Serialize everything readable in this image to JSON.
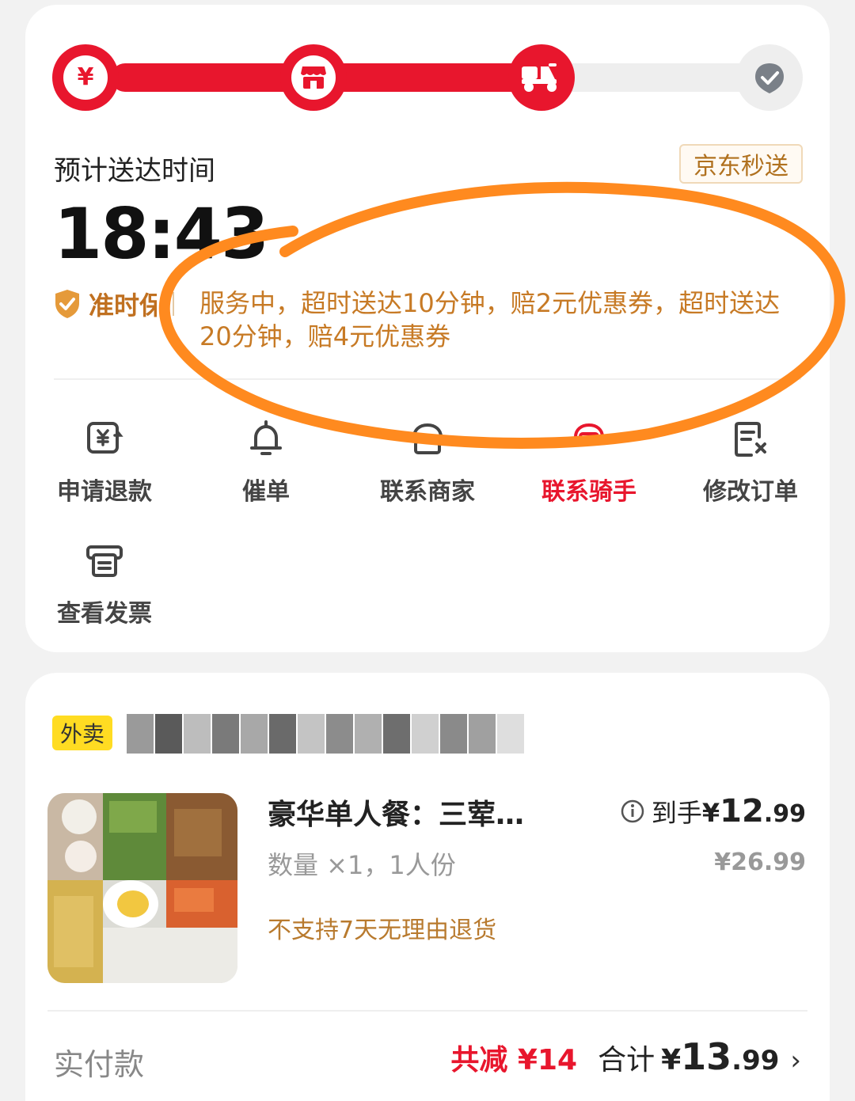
{
  "progress": {
    "steps": [
      {
        "name": "paid",
        "icon": "yuan-icon",
        "state": "done"
      },
      {
        "name": "merchant",
        "icon": "store-icon",
        "state": "done"
      },
      {
        "name": "delivering",
        "icon": "scooter-icon",
        "state": "current"
      },
      {
        "name": "delivered",
        "icon": "check-icon",
        "state": "pending"
      }
    ],
    "yuan_glyph": "¥"
  },
  "delivery": {
    "eta_label": "预计送达时间",
    "eta_time": "18:43",
    "service_badge": "京东秒送",
    "ontime_label": "准时保",
    "ontime_desc": "服务中，超时送达10分钟，赔2元优惠券，超时送达20分钟，赔4元优惠券"
  },
  "actions": [
    {
      "label": "申请退款",
      "icon": "refund-icon"
    },
    {
      "label": "催单",
      "icon": "bell-icon"
    },
    {
      "label": "联系商家",
      "icon": "merchant-chat-icon"
    },
    {
      "label": "联系骑手",
      "icon": "rider-icon",
      "highlight": true
    },
    {
      "label": "修改订单",
      "icon": "edit-order-icon"
    },
    {
      "label": "查看发票",
      "icon": "invoice-icon"
    }
  ],
  "order": {
    "tag": "外卖",
    "product": {
      "title": "豪华单人餐：三荤…",
      "qty": "数量 ×1，1人份",
      "policy": "不支持7天无理由退货",
      "price_label": "到手",
      "price_yen": "¥",
      "price_int": "12",
      "price_dec": ".99",
      "original_price": "¥26.99"
    },
    "payment": {
      "label": "实付款",
      "saved": "共减 ¥14",
      "total_label": "合计",
      "total_yen": "¥",
      "total_int": "13",
      "total_dec": ".99",
      "chevron": "›"
    }
  },
  "colors": {
    "accent_red": "#e8162d",
    "gold": "#c77a25",
    "annotation_orange": "#ff8a1f",
    "tag_yellow": "#ffdc22"
  }
}
